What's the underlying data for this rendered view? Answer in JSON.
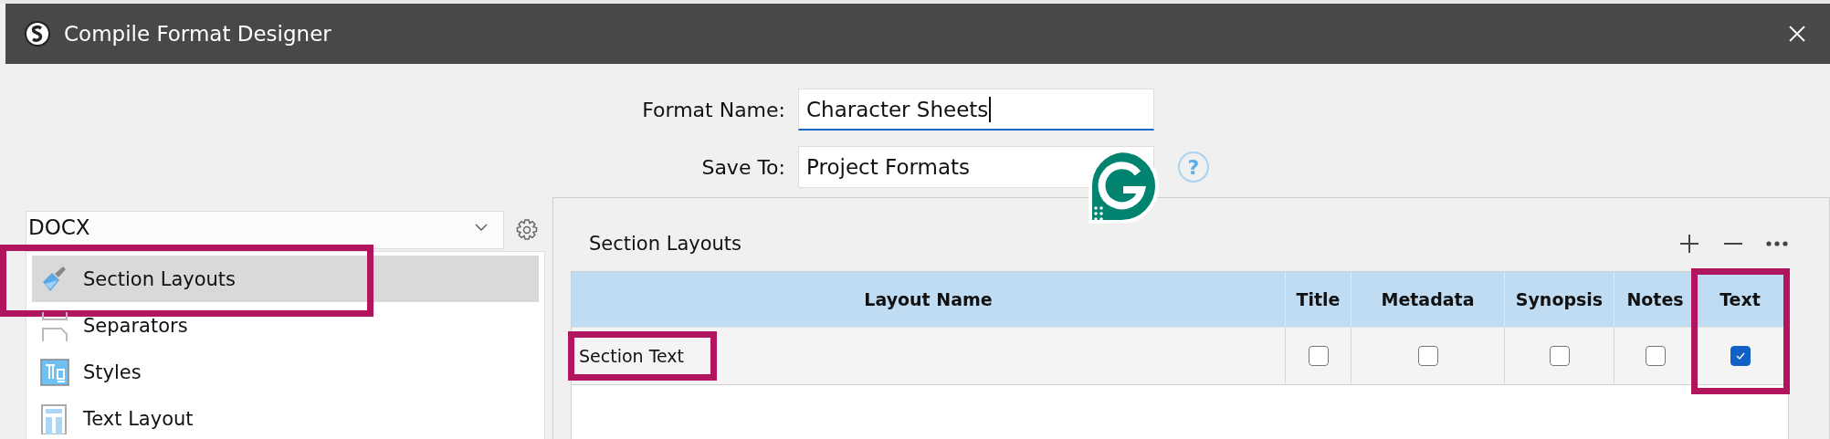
{
  "window": {
    "title": "Compile Format Designer"
  },
  "format_name": {
    "label": "Format Name:",
    "value": "Character Sheets"
  },
  "save_to": {
    "label": "Save To:",
    "value": "Project Formats",
    "help": "?"
  },
  "format_dropdown": {
    "value": "DOCX"
  },
  "sidebar": {
    "items": [
      {
        "label": "Section Layouts",
        "selected": true,
        "highlighted": true
      },
      {
        "label": "Separators",
        "selected": false,
        "highlighted": false
      },
      {
        "label": "Styles",
        "selected": false,
        "highlighted": false
      },
      {
        "label": "Text Layout",
        "selected": false,
        "highlighted": false
      }
    ]
  },
  "section_layouts": {
    "title": "Section Layouts",
    "table": {
      "columns": [
        {
          "label": "Layout Name",
          "highlighted": false
        },
        {
          "label": "Title",
          "highlighted": false
        },
        {
          "label": "Metadata",
          "highlighted": false
        },
        {
          "label": "Synopsis",
          "highlighted": false
        },
        {
          "label": "Notes",
          "highlighted": false
        },
        {
          "label": "Text",
          "highlighted": true
        }
      ],
      "rows": [
        {
          "name": "Section Text",
          "name_highlighted": true,
          "checks": [
            false,
            false,
            false,
            false,
            true
          ]
        }
      ]
    }
  }
}
